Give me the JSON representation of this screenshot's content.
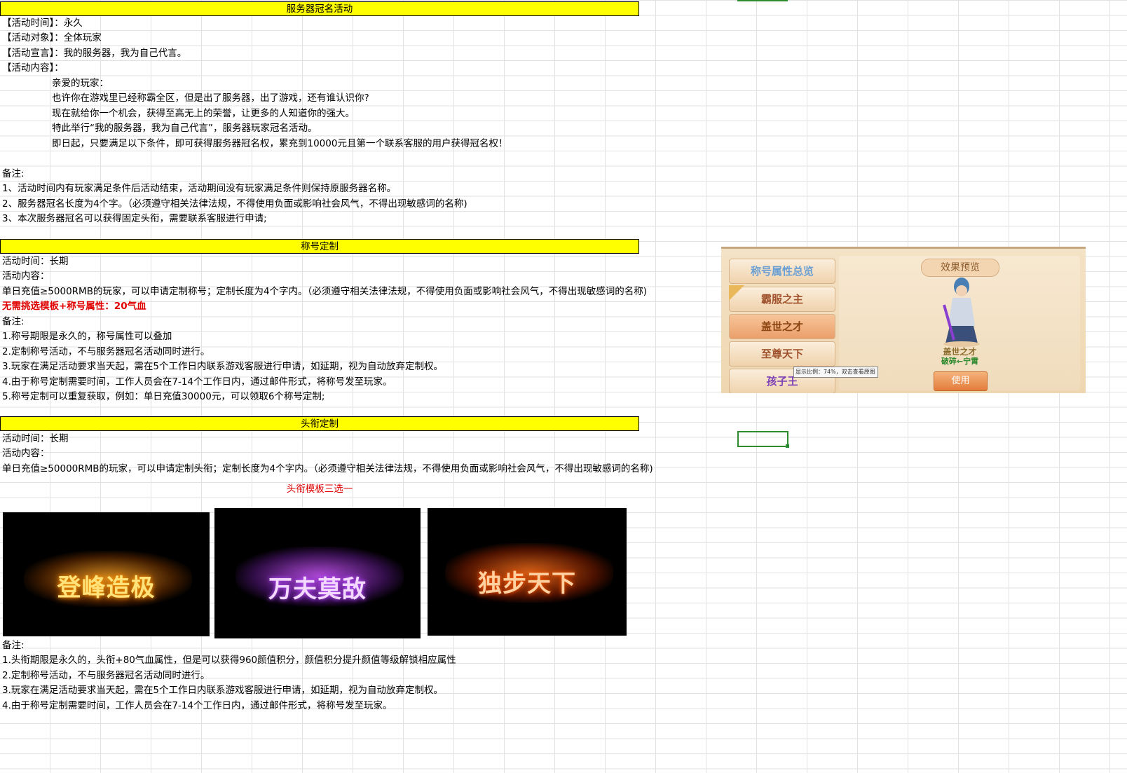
{
  "section1": {
    "header": "服务器冠名活动",
    "lines": [
      "【活动时间】：永久",
      "【活动对象】：全体玩家",
      "【活动宣言】：我的服务器，我为自己代言。",
      "【活动内容】："
    ],
    "indented": [
      "亲爱的玩家：",
      "也许你在游戏里已经称霸全区，但是出了服务器，出了游戏，还有谁认识你?",
      "现在就给你一个机会，获得至高无上的荣誉，让更多的人知道你的强大。",
      "特此举行“我的服务器，我为自己代言”，服务器玩家冠名活动。",
      "即日起，只要满足以下条件，即可获得服务器冠名权，累充到10000元且第一个联系客服的用户获得冠名权！"
    ],
    "notes": [
      "备注:",
      "1、活动时间内有玩家满足条件后活动结束，活动期间没有玩家满足条件则保持原服务器名称。",
      "2、服务器冠名长度为4个字。（必须遵守相关法律法规，不得使用负面或影响社会风气，不得出现敏感词的名称)",
      "3、本次服务器冠名可以获得固定头衔，需要联系客服进行申请;"
    ]
  },
  "section2": {
    "header": "称号定制",
    "lines": [
      "活动时间：长期",
      "活动内容：",
      "单日充值≥5000RMB的玩家，可以申请定制称号；定制长度为4个字内。（必须遵守相关法律法规，不得使用负面或影响社会风气，不得出现敏感词的名称)"
    ],
    "highlight": "无需挑选模板+称号属性：20气血",
    "notes": [
      "备注:",
      "1.称号期限是永久的，称号属性可以叠加",
      "2.定制称号活动，不与服务器冠名活动同时进行。",
      "3.玩家在满足活动要求当天起，需在5个工作日内联系游戏客服进行申请，如延期，视为自动放弃定制权。",
      "4.由于称号定制需要时间，工作人员会在7-14个工作日内，通过邮件形式，将称号发至玩家。",
      "5.称号定制可以重复获取，例如：单日充值30000元，可以领取6个称号定制;"
    ]
  },
  "panel": {
    "buttons": [
      "称号属性总览",
      "霸服之主",
      "盖世之才",
      "至尊天下",
      "孩子王"
    ],
    "preview_title": "效果预览",
    "char_title": "盖世之才",
    "char_name": "破碎←宁霄",
    "use_label": "使用",
    "tooltip": "显示比例：74%，双击查看原图"
  },
  "section3": {
    "header": "头衔定制",
    "lines": [
      "活动时间：长期",
      "活动内容：",
      "单日充值≥50000RMB的玩家，可以申请定制头衔；定制长度为4个字内。（必须遵守相关法律法规，不得使用负面或影响社会风气，不得出现敏感词的名称)"
    ],
    "template_caption": "头衔模板三选一",
    "banners": [
      "登峰造极",
      "万夫莫敌",
      "独步天下"
    ],
    "notes": [
      "备注:",
      "1.头衔期限是永久的，头衔+80气血属性，但是可以获得960颜值积分，颜值积分提升颜值等级解锁相应属性",
      "2.定制称号活动，不与服务器冠名活动同时进行。",
      "3.玩家在满足活动要求当天起，需在5个工作日内联系游戏客服进行申请，如延期，视为自动放弃定制权。",
      "4.由于称号定制需要时间，工作人员会在7-14个工作日内，通过邮件形式，将称号发至玩家。"
    ]
  },
  "colors": {
    "header_bg": "#ffff00",
    "highlight_red": "#e00000",
    "selection_green": "#2e8b2e"
  }
}
